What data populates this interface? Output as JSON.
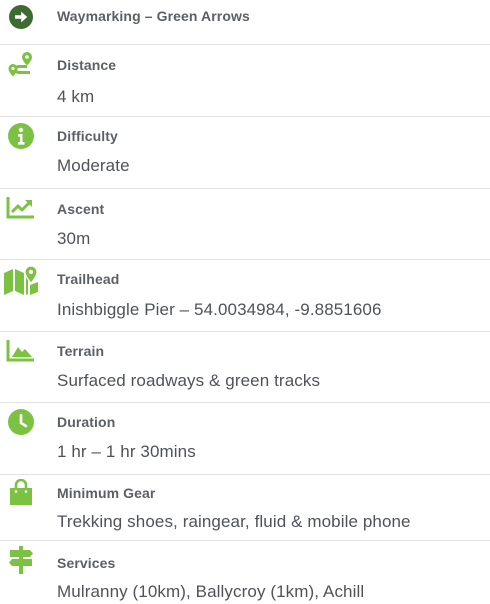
{
  "accent_color": "#7cc242",
  "waymarking": {
    "icon": "arrow-right-circle-icon",
    "label": "Waymarking – Green Arrows"
  },
  "items": [
    {
      "icon": "route-icon",
      "label": "Distance",
      "value": "4 km"
    },
    {
      "icon": "info-icon",
      "label": "Difficulty",
      "value": "Moderate"
    },
    {
      "icon": "trend-chart-icon",
      "label": "Ascent",
      "value": "30m"
    },
    {
      "icon": "map-pin-icon",
      "label": "Trailhead",
      "value": "Inishbiggle Pier – 54.0034984, -9.8851606"
    },
    {
      "icon": "mountain-icon",
      "label": "Terrain",
      "value": "Surfaced roadways & green tracks"
    },
    {
      "icon": "clock-icon",
      "label": "Duration",
      "value": "1 hr – 1 hr 30mins"
    },
    {
      "icon": "shopping-bag-icon",
      "label": "Minimum Gear",
      "value": "Trekking shoes, raingear, fluid & mobile phone"
    },
    {
      "icon": "signpost-icon",
      "label": "Services",
      "value": "Mulranny (10km), Ballycroy (1km), Achill"
    }
  ]
}
